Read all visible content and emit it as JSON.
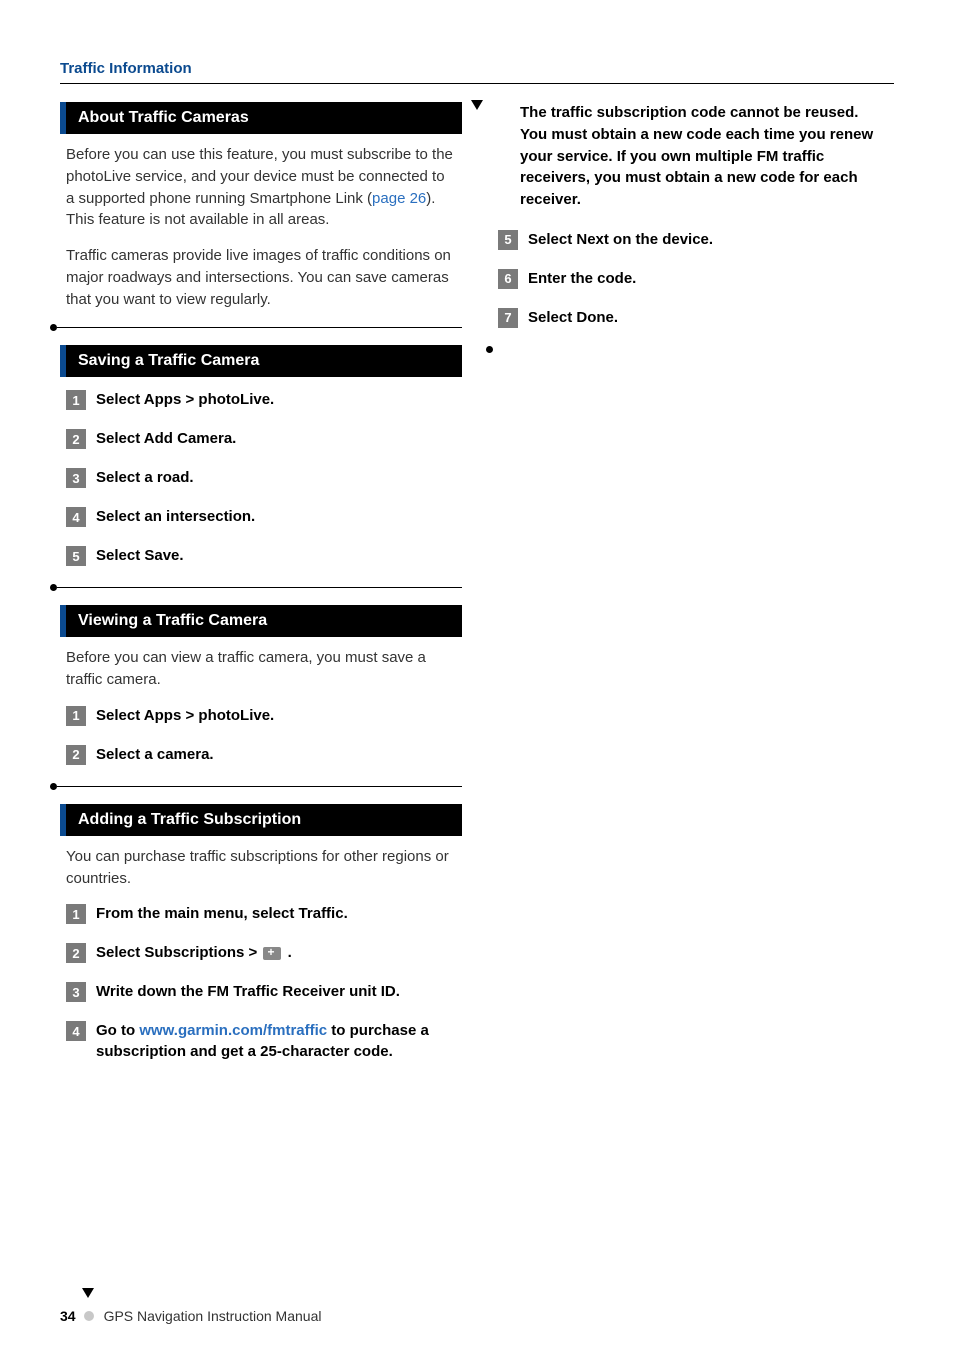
{
  "header": "Traffic Information",
  "left": {
    "sections": [
      {
        "title": "About Traffic Cameras",
        "paragraphs": [
          {
            "pre": "Before you can use this feature, you must subscribe to the photoLive service, and your device must be connected to a supported phone running Smartphone Link (",
            "link": "page 26",
            "post": "). This feature is not available in all areas."
          },
          {
            "pre": "Traffic cameras provide live images of traffic conditions on major roadways and intersections. You can save cameras that you want to view regularly.",
            "link": "",
            "post": ""
          }
        ]
      },
      {
        "title": "Saving a Traffic Camera",
        "steps": [
          "Select Apps > photoLive.",
          "Select Add Camera.",
          "Select a road.",
          "Select an intersection.",
          "Select Save."
        ]
      },
      {
        "title": "Viewing a Traffic Camera",
        "intro": "Before you can view a traffic camera, you must save a traffic camera.",
        "steps": [
          "Select Apps > photoLive.",
          "Select a camera."
        ]
      },
      {
        "title": "Adding a Traffic Subscription",
        "intro": "You can purchase traffic subscriptions for other regions or countries.",
        "steps_rich": [
          {
            "text": "From the main menu, select Traffic."
          },
          {
            "prefix": "Select Subscriptions > ",
            "icon": true,
            "suffix": " ."
          },
          {
            "text": "Write down the FM Traffic Receiver unit ID."
          },
          {
            "prefix": "Go to ",
            "link": "www.garmin.com/fmtraffic",
            "suffix": " to purchase a subscription and get a 25-character code."
          }
        ]
      }
    ]
  },
  "right": {
    "note": "The traffic subscription code cannot be reused. You must obtain a new code each time you renew your service. If you own multiple FM traffic receivers, you must obtain a new code for each receiver.",
    "steps": [
      {
        "num": "5",
        "text": "Select Next on the device."
      },
      {
        "num": "6",
        "text": "Enter the code."
      },
      {
        "num": "7",
        "text": "Select Done."
      }
    ]
  },
  "footer": {
    "page_num": "34",
    "title": "GPS Navigation Instruction Manual"
  }
}
